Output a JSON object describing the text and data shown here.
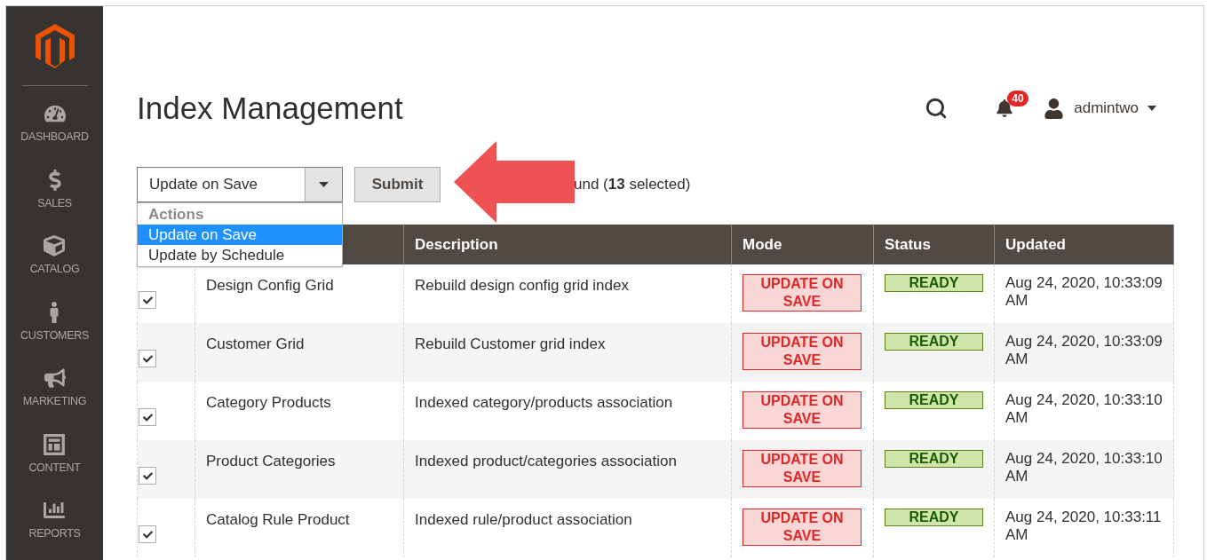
{
  "sidebar": {
    "items": [
      {
        "label": "DASHBOARD"
      },
      {
        "label": "SALES"
      },
      {
        "label": "CATALOG"
      },
      {
        "label": "CUSTOMERS"
      },
      {
        "label": "MARKETING"
      },
      {
        "label": "CONTENT"
      },
      {
        "label": "REPORTS"
      }
    ]
  },
  "page_title": "Index Management",
  "header": {
    "notifications_count": "40",
    "user": "admintwo"
  },
  "toolbar": {
    "action_select": {
      "value": "Update on Save",
      "expanded": true,
      "group_label": "Actions",
      "options": [
        {
          "label": "Update on Save",
          "selected": true
        },
        {
          "label": "Update by Schedule",
          "selected": false
        }
      ]
    },
    "submit": "Submit",
    "records_found": "und (**13** selected)"
  },
  "table": {
    "columns": [
      "Description",
      "Mode",
      "Status",
      "Updated"
    ],
    "rows": [
      {
        "checked": true,
        "indexer": "Design Config Grid",
        "description": "Rebuild design config grid index",
        "mode": "UPDATE ON SAVE",
        "status": "READY",
        "updated": "Aug 24, 2020, 10:33:09 AM"
      },
      {
        "checked": true,
        "indexer": "Customer Grid",
        "description": "Rebuild Customer grid index",
        "mode": "UPDATE ON SAVE",
        "status": "READY",
        "updated": "Aug 24, 2020, 10:33:09 AM"
      },
      {
        "checked": true,
        "indexer": "Category Products",
        "description": "Indexed category/products association",
        "mode": "UPDATE ON SAVE",
        "status": "READY",
        "updated": "Aug 24, 2020, 10:33:10 AM"
      },
      {
        "checked": true,
        "indexer": "Product Categories",
        "description": "Indexed product/categories association",
        "mode": "UPDATE ON SAVE",
        "status": "READY",
        "updated": "Aug 24, 2020, 10:33:10 AM"
      },
      {
        "checked": true,
        "indexer": "Catalog Rule Product",
        "description": "Indexed rule/product association",
        "mode": "UPDATE ON SAVE",
        "status": "READY",
        "updated": "Aug 24, 2020, 10:33:11 AM"
      }
    ]
  }
}
